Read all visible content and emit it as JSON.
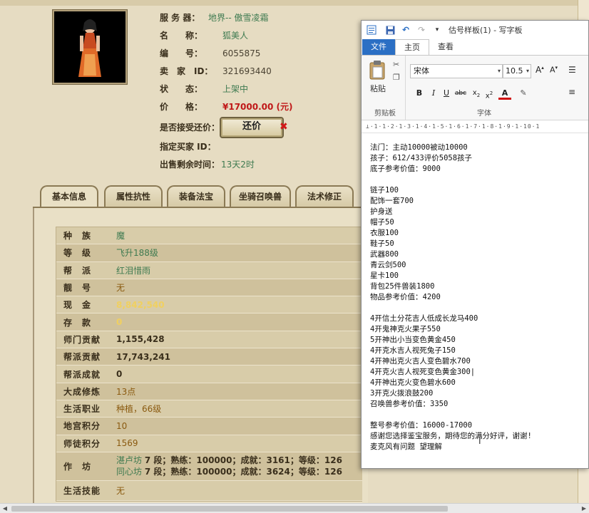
{
  "listing": {
    "server_label": "服 务 器：",
    "server_value": "地界-- 傲雪凌霜",
    "name_label": "名　　称：",
    "name_value": "狐美人",
    "id_label": "编　　号：",
    "id_value": "6055875",
    "seller_label": "卖　家　ID：",
    "seller_value": "321693440",
    "status_label": "状　　态：",
    "status_value": "上架中",
    "price_label": "价　　格：",
    "price_value": "¥17000.00 (元)",
    "counter_label": "是否接受还价：",
    "counter_button": "还价",
    "counter_x": "✖",
    "buyer_label": "指定买家 ID：",
    "time_label": "出售剩余时间：",
    "time_value": "13天2时"
  },
  "tabs": [
    "基本信息",
    "属性抗性",
    "装备法宝",
    "坐骑召唤兽",
    "法术修正"
  ],
  "stats": [
    {
      "key": "种　族",
      "value": "魔",
      "style": "green"
    },
    {
      "key": "等　级",
      "value": "飞升188级",
      "style": "green"
    },
    {
      "key": "帮　派",
      "value": "红泪惜雨",
      "style": "green"
    },
    {
      "key": "靓　号",
      "value": "无",
      "style": "orange"
    },
    {
      "key": "现　金",
      "value": "8,842,540",
      "style": "yellow"
    },
    {
      "key": "存　款",
      "value": "0",
      "style": "yellow"
    },
    {
      "key": "师门贡献",
      "value": "1,155,428",
      "style": "dark"
    },
    {
      "key": "帮派贡献",
      "value": "17,743,241",
      "style": "dark"
    },
    {
      "key": "帮派成就",
      "value": "0",
      "style": "dark"
    },
    {
      "key": "大成修炼",
      "value": "13点",
      "style": "orange"
    },
    {
      "key": "生活职业",
      "value": "种植，66级",
      "style": "orange"
    },
    {
      "key": "地宫积分",
      "value": "10",
      "style": "orange"
    },
    {
      "key": "师徒积分",
      "value": "1569",
      "style": "orange"
    }
  ],
  "workshop": {
    "key": "作　坊",
    "line1_name": "湛卢坊",
    "line1_rest": "7 段；熟练：100000；成就：3161；等级：126",
    "line2_name": "同心坊",
    "line2_rest": "7 段；熟练：100000；成就：3624；等级：126"
  },
  "life_skill": {
    "key": "生活技能",
    "value": "无"
  },
  "word": {
    "title": "估号样板(1) - 写字板",
    "tab_file": "文件",
    "tab_home": "主页",
    "tab_view": "查看",
    "paste_label": "粘贴",
    "clipboard_label": "剪贴板",
    "font_name": "宋体",
    "font_size": "10.5",
    "font_group_label": "字体",
    "ruler_text": "⊥·1·1·2·1·3·1·4·1·5·1·6·1·7·1·8·1·9·1·10·1",
    "doc_lines": [
      "法门：主动10000被动10000",
      "孩子：612/433评价5058孩子",
      "底子参考价值：9000",
      "",
      "链子100",
      "配饰一套700",
      "护身送",
      "帽子50",
      "衣服100",
      "鞋子50",
      "武器800",
      "青云剑500",
      "星卡100",
      "背包25件兽装1800",
      "物品参考价值：4200",
      "",
      "4开信土分花吉人低成长龙马400",
      "4开鬼神克火果子550",
      "5开神出小当变色黄金450",
      "4开克水吉人视死兔子150",
      "4开神出克火吉人变色碧水700",
      "4开克火吉人视死变色黄金300|",
      "4开神出克火变色碧水600",
      "3开克火拨浪鼓200",
      "召唤兽参考价值：3350",
      "",
      "整号参考价值：16000-17000",
      "感谢您选择鉴宝服务，期待您的满分好评，谢谢!",
      "麦克风有问题 望理解"
    ]
  },
  "colors": {
    "panel_bg": "#e6dcc2",
    "price_red": "#c01818",
    "green_text": "#3e7a50",
    "word_file_blue": "#2b6fc4"
  }
}
